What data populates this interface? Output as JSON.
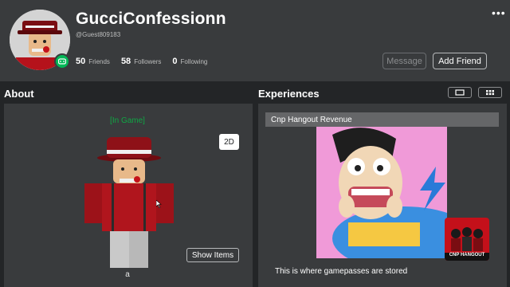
{
  "profile": {
    "display_name": "GucciConfessionn",
    "username": "@Guest809183",
    "stats": [
      {
        "value": "50",
        "label": "Friends"
      },
      {
        "value": "58",
        "label": "Followers"
      },
      {
        "value": "0",
        "label": "Following"
      }
    ],
    "more_icon": "more-dots-icon",
    "buttons": {
      "message": "Message",
      "add_friend": "Add Friend"
    }
  },
  "about": {
    "title": "About",
    "status": "[In Game]",
    "view_toggle": "2D",
    "show_items": "Show Items",
    "avatar_caption": "a"
  },
  "experiences": {
    "title": "Experiences",
    "game_title": "Cnp Hangout Revenue",
    "description": "This is where gamepasses are stored",
    "badge_text": "CNP HANGOUT",
    "view_icons": [
      "list-view-icon",
      "grid-view-icon"
    ]
  },
  "colors": {
    "background": "#232527",
    "card": "#393b3d",
    "online": "#02b757",
    "in_game": "#0fa744"
  }
}
